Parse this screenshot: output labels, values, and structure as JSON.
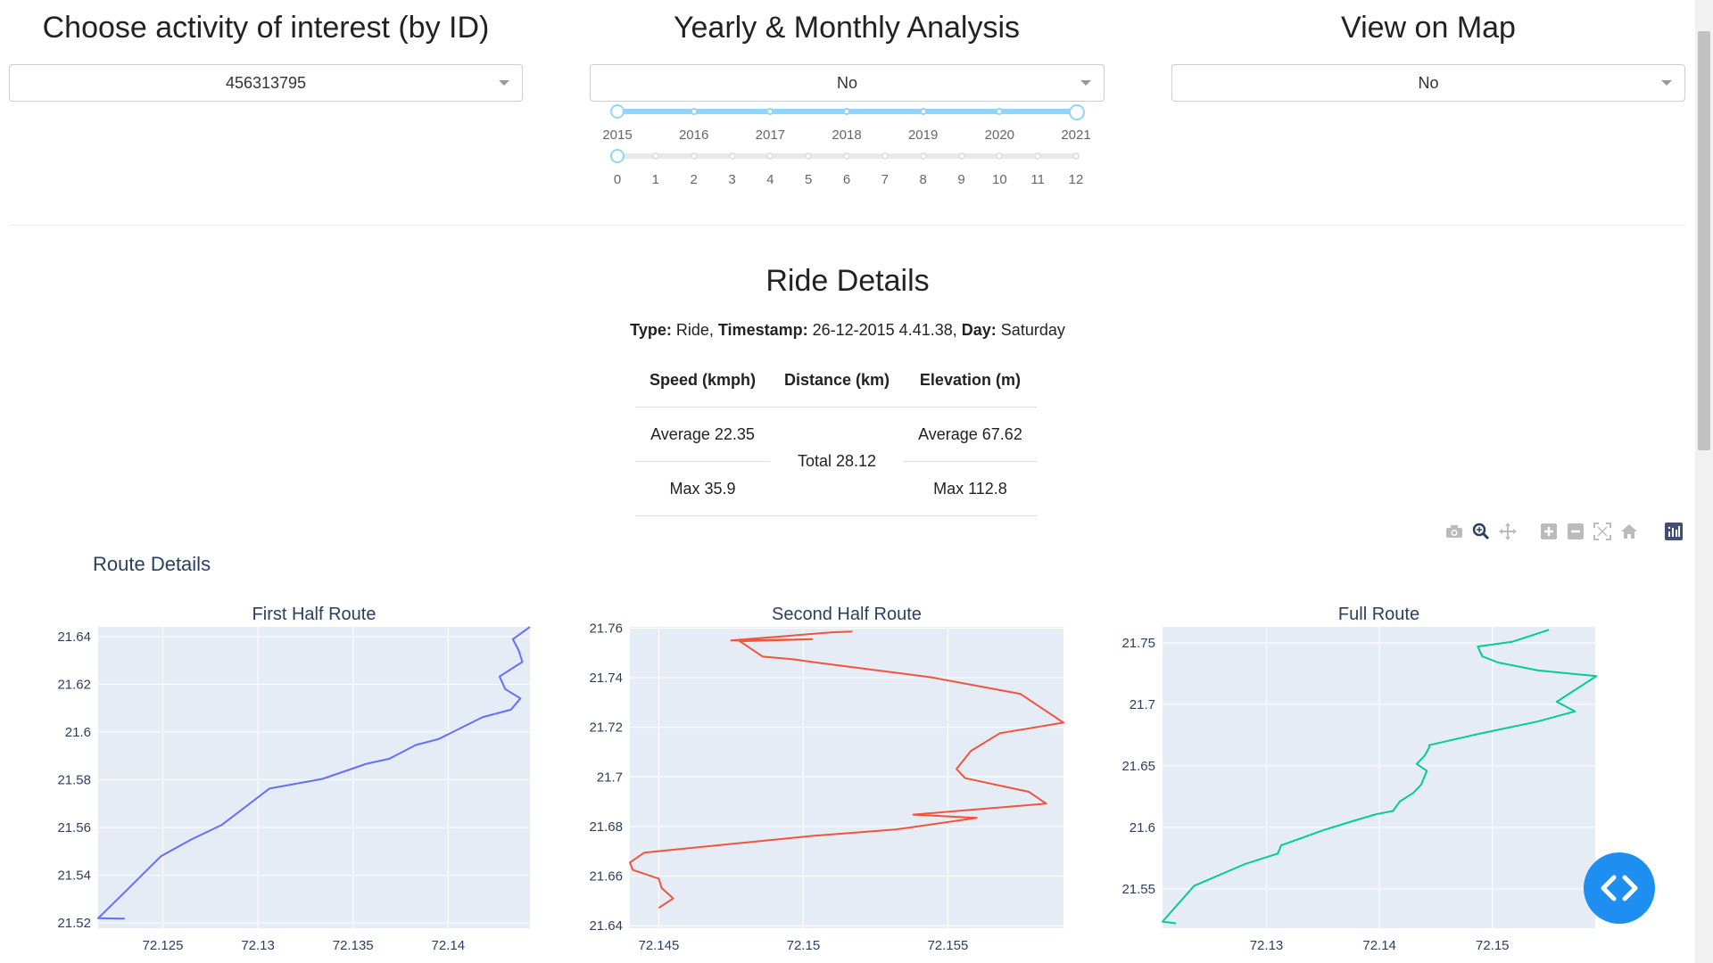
{
  "controls": {
    "activity": {
      "title": "Choose activity of interest (by ID)",
      "selected": "456313795"
    },
    "analysis": {
      "title": "Yearly & Monthly Analysis",
      "selected": "No"
    },
    "map": {
      "title": "View on Map",
      "selected": "No"
    }
  },
  "year_slider": {
    "marks": [
      "2015",
      "2016",
      "2017",
      "2018",
      "2019",
      "2020",
      "2021"
    ],
    "selected_range": [
      "2015",
      "2021"
    ]
  },
  "month_slider": {
    "marks": [
      "0",
      "1",
      "2",
      "3",
      "4",
      "5",
      "6",
      "7",
      "8",
      "9",
      "10",
      "11",
      "12"
    ],
    "selected": "0"
  },
  "ride": {
    "title": "Ride Details",
    "type_label": "Type:",
    "type_value": "Ride,",
    "timestamp_label": "Timestamp:",
    "timestamp_value": "26-12-2015 4.41.38,",
    "day_label": "Day:",
    "day_value": "Saturday",
    "table": {
      "headers": [
        "Speed (kmph)",
        "Distance (km)",
        "Elevation (m)"
      ],
      "speed_avg": "Average 22.35",
      "speed_max": "Max 35.9",
      "distance_total": "Total 28.12",
      "elevation_avg": "Average 67.62",
      "elevation_max": "Max 112.8"
    }
  },
  "route_plot": {
    "title": "Route Details"
  },
  "colors": {
    "first": "#636efa",
    "second": "#ef553b",
    "full": "#00cc96",
    "plot_bg": "#e5ecf6",
    "accent": "#1f8ef1"
  },
  "chart_data": [
    {
      "type": "line",
      "title": "First Half Route",
      "xlim": [
        72.1216,
        72.1443
      ],
      "ylim": [
        21.5178,
        21.6441
      ],
      "xticks": [
        "72.125",
        "72.13",
        "72.135",
        "72.14"
      ],
      "xtick_values": [
        72.125,
        72.13,
        72.135,
        72.14
      ],
      "yticks": [
        "21.52",
        "21.54",
        "21.56",
        "21.58",
        "21.6",
        "21.62",
        "21.64"
      ],
      "ytick_values": [
        21.52,
        21.54,
        21.56,
        21.58,
        21.6,
        21.62,
        21.64
      ],
      "x": [
        72.123,
        72.1216,
        72.1232,
        72.1249,
        72.1265,
        72.1281,
        72.1306,
        72.1334,
        72.1349,
        72.1357,
        72.1369,
        72.1383,
        72.1395,
        72.1418,
        72.1433,
        72.1438,
        72.143,
        72.1427,
        72.1439,
        72.1437,
        72.1434,
        72.1443
      ],
      "y": [
        21.5218,
        21.522,
        21.5345,
        21.548,
        21.555,
        21.5611,
        21.5763,
        21.5804,
        21.5845,
        21.5867,
        21.5888,
        21.5946,
        21.5971,
        21.6062,
        21.6094,
        21.6141,
        21.618,
        21.6233,
        21.6294,
        21.6344,
        21.6389,
        21.6441
      ]
    },
    {
      "type": "line",
      "title": "Second Half Route",
      "xlim": [
        72.144,
        72.159
      ],
      "ylim": [
        21.639,
        21.7605
      ],
      "xticks": [
        "72.145",
        "72.15",
        "72.155"
      ],
      "xtick_values": [
        72.145,
        72.15,
        72.155
      ],
      "yticks": [
        "21.64",
        "21.66",
        "21.68",
        "21.7",
        "21.72",
        "21.74",
        "21.76"
      ],
      "ytick_values": [
        21.64,
        21.66,
        21.68,
        21.7,
        21.72,
        21.74,
        21.76
      ],
      "x": [
        72.1517,
        72.151,
        72.1475,
        72.1503,
        72.1478,
        72.1486,
        72.1496,
        72.1505,
        72.1544,
        72.1575,
        72.159,
        72.1568,
        72.1558,
        72.1553,
        72.1556,
        72.1578,
        72.1584,
        72.1538,
        72.156,
        72.1532,
        72.1503,
        72.147,
        72.1445,
        72.144,
        72.1441,
        72.145,
        72.1451,
        72.1455,
        72.145
      ],
      "y": [
        21.7586,
        21.7583,
        21.755,
        21.7555,
        21.7547,
        21.7485,
        21.7475,
        21.746,
        21.7402,
        21.7335,
        21.7219,
        21.7176,
        21.7105,
        21.7032,
        21.6995,
        21.694,
        21.6892,
        21.6848,
        21.6835,
        21.6788,
        21.6762,
        21.6724,
        21.6695,
        21.6655,
        21.6625,
        21.659,
        21.6552,
        21.651,
        21.6472
      ]
    },
    {
      "type": "line",
      "title": "Full Route",
      "xlim": [
        72.1208,
        72.1591
      ],
      "ylim": [
        21.518,
        21.763
      ],
      "xticks": [
        "72.13",
        "72.14",
        "72.15"
      ],
      "xtick_values": [
        72.13,
        72.14,
        72.15
      ],
      "yticks": [
        "21.55",
        "21.6",
        "21.65",
        "21.7",
        "21.75"
      ],
      "ytick_values": [
        21.55,
        21.6,
        21.65,
        21.7,
        21.75
      ],
      "x": [
        72.122,
        72.1208,
        72.1236,
        72.1281,
        72.131,
        72.1313,
        72.1318,
        72.135,
        72.1376,
        72.1397,
        72.1412,
        72.1418,
        72.143,
        72.1437,
        72.1442,
        72.1433,
        72.144,
        72.1444,
        72.1444,
        72.1488,
        72.154,
        72.1573,
        72.1557,
        72.1592,
        72.1541,
        72.1505,
        72.1491,
        72.1487,
        72.1518,
        72.155
      ],
      "y": [
        21.522,
        21.5234,
        21.5525,
        21.5702,
        21.5787,
        21.5855,
        21.587,
        21.5976,
        21.605,
        21.6106,
        21.6133,
        21.621,
        21.628,
        21.6348,
        21.646,
        21.6515,
        21.6582,
        21.665,
        21.6668,
        21.676,
        21.686,
        21.6943,
        21.7021,
        21.723,
        21.7275,
        21.734,
        21.739,
        21.747,
        21.751,
        21.7606
      ]
    }
  ]
}
